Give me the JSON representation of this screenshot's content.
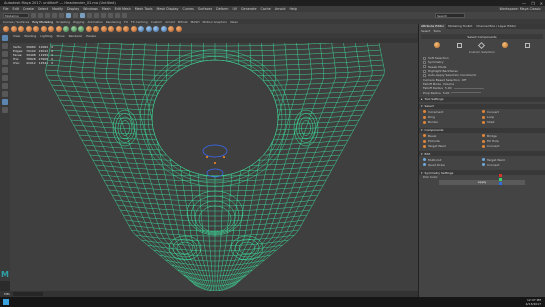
{
  "window": {
    "title": "Autodesk Maya 2017: untitled* --- Headrender_02.ma (Untitled)",
    "controls": [
      "—",
      "❐",
      "✕"
    ]
  },
  "menubar": {
    "items": [
      "File",
      "Edit",
      "Create",
      "Select",
      "Modify",
      "Display",
      "Windows",
      "Mesh",
      "Edit Mesh",
      "Mesh Tools",
      "Mesh Display",
      "Curves",
      "Surfaces",
      "Deform",
      "UV",
      "Generate",
      "Cache",
      "Arnold",
      "Help"
    ],
    "workspace": "Workspace: Maya Classic"
  },
  "statusline": {
    "mode": "Modeling",
    "search_placeholder": "Search"
  },
  "shelf_tabs": [
    "Curves / Surfaces",
    "Poly Modeling",
    "Sculpting",
    "Rigging",
    "Animation",
    "Rendering",
    "FX",
    "FX Caching",
    "Custom",
    "Arnold",
    "Bifrost",
    "MASH",
    "Motion Graphics",
    "XGen"
  ],
  "shelf_active": "Poly Modeling",
  "viewport": {
    "menu": [
      "View",
      "Shading",
      "Lighting",
      "Show",
      "Renderer",
      "Panels"
    ],
    "hud": [
      [
        "Verts:",
        "39684",
        "12062",
        "0"
      ],
      [
        "Edges:",
        "79104",
        "24012",
        "0"
      ],
      [
        "Faces:",
        "39498",
        "11950",
        "0"
      ],
      [
        "Tris:",
        "78828",
        "23900",
        "0"
      ],
      [
        "UVs:",
        "41012",
        "12541",
        "0"
      ]
    ],
    "wire_color": "#3ce8a0"
  },
  "scriptbar": {
    "label": "MEL"
  },
  "attribute_editor": {
    "tabs": [
      "Attribute Editor",
      "Modeling Toolkit",
      "Channel Box / Layer Editor"
    ],
    "menu": [
      "Select",
      "Tools"
    ],
    "node": "Select Components",
    "caption": "Custom Selection",
    "options": [
      {
        "label": "Soft Selection",
        "checked": true
      },
      {
        "label": "Symmetry",
        "checked": false
      },
      {
        "label": "Tweak Mode",
        "checked": false
      },
      {
        "label": "Highlight Backfaces",
        "checked": true
      },
      {
        "label": "Auto-Apply Selection Constraint",
        "checked": false
      }
    ],
    "values": [
      {
        "label": "Camera Based Selection",
        "value": "Off"
      },
      {
        "label": "Falloff Mode",
        "value": "Volume"
      },
      {
        "label": "Falloff Radius",
        "value": "5.00"
      },
      {
        "label": "Prop Radius",
        "value": "5.00"
      }
    ],
    "sections": {
      "tool_settings": "Tool Settings",
      "select": "Select",
      "components": "Components",
      "edit": "Edit",
      "sym": "Symmetry Settings"
    },
    "select_ops": [
      "Increment",
      "Convert",
      "Ring",
      "Loop",
      "Border",
      "Shell"
    ],
    "comp_ops": [
      "Bevel",
      "Bridge",
      "Extrude",
      "Fill Hole",
      "Target Weld",
      "Connect"
    ],
    "edit_ops": [
      "Multi-Cut",
      "Target Weld",
      "Quad Draw",
      "Connect"
    ],
    "pick_label": "Pick Color",
    "apply_label": "Apply",
    "colors": [
      "#d8342e",
      "#3cd46a",
      "#2f6ee0"
    ]
  },
  "taskbar": {
    "time": "12:37 PM",
    "date": "4/13/2017"
  }
}
